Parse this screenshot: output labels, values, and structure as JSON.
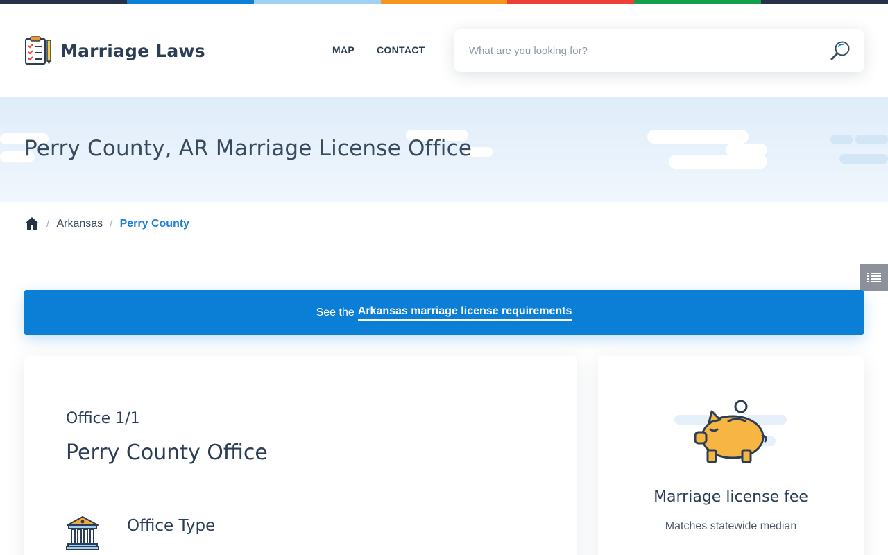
{
  "colors": {
    "topbar": [
      "#263248",
      "#0b7fd5",
      "#9fd2f2",
      "#f7941d",
      "#ef4035",
      "#12a04a",
      "#263248"
    ],
    "accent": "#0b7fd5",
    "text": "#2c3e55"
  },
  "header": {
    "logo_text": "Marriage Laws",
    "logo_icon": "checklist-pencil-icon",
    "nav": [
      {
        "label": "MAP"
      },
      {
        "label": "CONTACT"
      }
    ],
    "search": {
      "placeholder": "What are you looking for?",
      "icon": "search-icon"
    }
  },
  "hero": {
    "title": "Perry County, AR Marriage License Office"
  },
  "breadcrumb": {
    "home_icon": "home-icon",
    "items": [
      "Arkansas",
      "Perry County"
    ]
  },
  "toc_tab": {
    "icon": "list-icon"
  },
  "banner": {
    "prefix": "See the",
    "link_text": "Arkansas marriage license requirements"
  },
  "office": {
    "count_label": "Office 1/1",
    "name": "Perry County Office",
    "type_label": "Office Type",
    "type_icon": "courthouse-icon"
  },
  "fee": {
    "icon": "piggy-bank-icon",
    "title": "Marriage license fee",
    "subtitle": "Matches statewide median"
  }
}
